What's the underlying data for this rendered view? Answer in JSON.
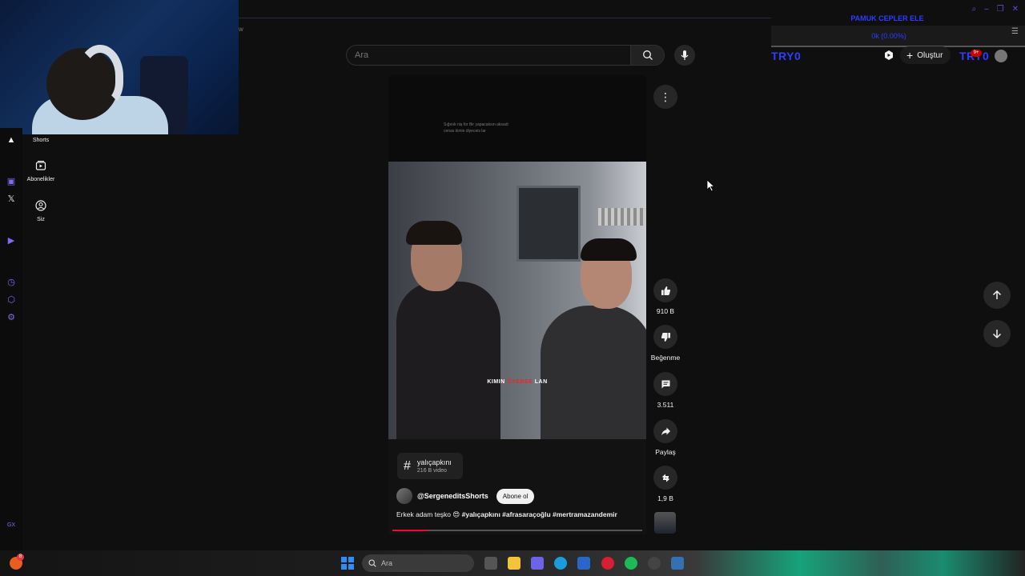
{
  "webcam": {
    "present": true
  },
  "app_strip": {
    "icons": [
      "x-icon",
      "twitch-icon",
      "play-icon",
      "clock-icon",
      "puzzle-icon",
      "settings-icon"
    ],
    "accent": "#7e6cf0",
    "footer_label": "GX"
  },
  "guide": {
    "items": [
      {
        "label": "Shorts",
        "icon": "shorts-icon"
      },
      {
        "label": "Abonelikler",
        "icon": "subscriptions-icon"
      },
      {
        "label": "Siz",
        "icon": "you-icon"
      }
    ]
  },
  "masthead": {
    "search_placeholder": "Ara",
    "create_label": "Oluştur",
    "notification_count": "9+",
    "brand_left": "TRY0",
    "brand_right": "TRY0"
  },
  "stream_overlay": {
    "title": "PAMUK CEPLER ELE",
    "progress_text": "0k (0.00%)",
    "accent": "#2d3cff"
  },
  "short": {
    "caption_lines": [
      "Sığınık niş for Bir yapacaksın aksadi",
      "cenas kimin diyeceis lar"
    ],
    "overlay_text": {
      "pre": "KIMIN ",
      "red": "ÖYEBEE",
      "post": " LAN"
    },
    "hashtag": {
      "name": "yalıçapkını",
      "count": "216 B video"
    },
    "channel": "@SergeneditsShorts",
    "subscribe_label": "Abone ol",
    "description_prefix": "Erkek adam teşko 😍 ",
    "description_tags": "#yalıçapkını #afrasaraçoğlu #mertramazandemir",
    "progress_fraction": 0.14
  },
  "actions": {
    "like": "910 B",
    "dislike": "Beğenme",
    "comments": "3.511",
    "share": "Paylaş",
    "remix": "1,9 B"
  },
  "taskbar": {
    "search_placeholder": "Ara",
    "tray_badge": "8"
  }
}
